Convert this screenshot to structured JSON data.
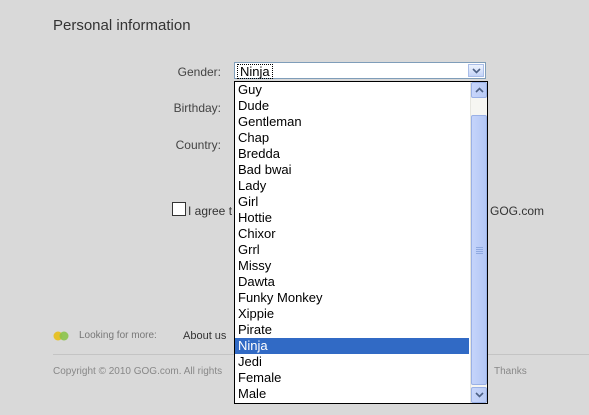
{
  "form": {
    "section_title": "Personal information",
    "gender_label": "Gender:",
    "birthday_label": "Birthday:",
    "country_label": "Country:",
    "gender_value": "Ninja",
    "agree_text": "I agree t",
    "agree_tail": "g GOG.com"
  },
  "dropdown": {
    "options": [
      "Guy",
      "Dude",
      "Gentleman",
      "Chap",
      "Bredda",
      "Bad bwai",
      "Lady",
      "Girl",
      "Hottie",
      "Chixor",
      "Grrl",
      "Missy",
      "Dawta",
      "Funky Monkey",
      "Xippie",
      "Pirate",
      "Ninja",
      "Jedi",
      "Female",
      "Male"
    ],
    "selected": "Ninja"
  },
  "footer": {
    "looking": "Looking for more:",
    "about": "About us",
    "copyright": "Copyright © 2010 GOG.com. All rights",
    "thanks": "Thanks"
  },
  "colors": {
    "selection": "#316ac5",
    "background": "#d9d9d9"
  },
  "icons": {
    "select_button": "chevron-down-icon",
    "scroll_up": "chevron-up-icon",
    "scroll_down": "chevron-down-icon",
    "footer": "gog-dots-icon"
  }
}
